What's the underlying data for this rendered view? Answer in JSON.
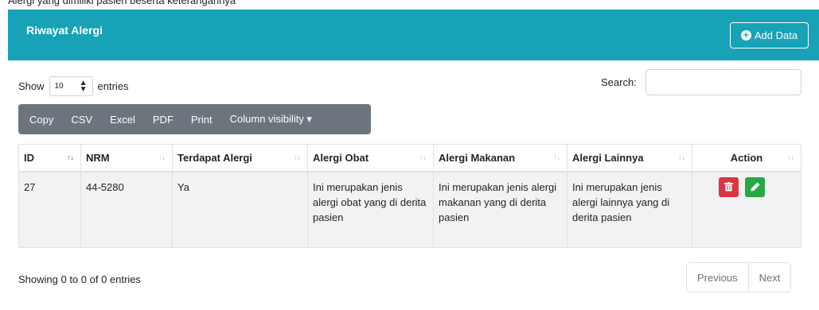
{
  "top_note": "Alergi yang dimiliki pasien beserta keterangannya",
  "card": {
    "title": "Riwayat Alergi",
    "add_button": "Add Data",
    "accent_color": "#17a2b8"
  },
  "length": {
    "show_label": "Show",
    "selected": "10",
    "entries_label": "entries"
  },
  "search": {
    "label": "Search:",
    "value": ""
  },
  "buttons": [
    "Copy",
    "CSV",
    "Excel",
    "PDF",
    "Print",
    "Column visibility ▾"
  ],
  "table": {
    "columns": [
      "ID",
      "NRM",
      "Terdapat Alergi",
      "Alergi Obat",
      "Alergi Makanan",
      "Alergi Lainnya",
      "Action"
    ],
    "rows": [
      {
        "id": "27",
        "nrm": "44-5280",
        "terdapat": "Ya",
        "obat": "Ini merupakan jenis alergi obat yang di derita pasien",
        "makanan": "Ini merupakan jenis alergi makanan yang di derita pasien",
        "lainnya": "Ini merupakan jenis alergi lainnya yang di derita pasien"
      }
    ]
  },
  "info": "Showing 0 to 0 of 0 entries",
  "pagination": {
    "previous": "Previous",
    "next": "Next"
  },
  "icons": {
    "add": "plus-circle-icon",
    "delete": "trash-icon",
    "edit": "pencil-icon",
    "sort": "sort-arrows-icon"
  },
  "colors": {
    "delete": "#dc3545",
    "edit": "#28a745",
    "toolbar": "#6c757d"
  }
}
